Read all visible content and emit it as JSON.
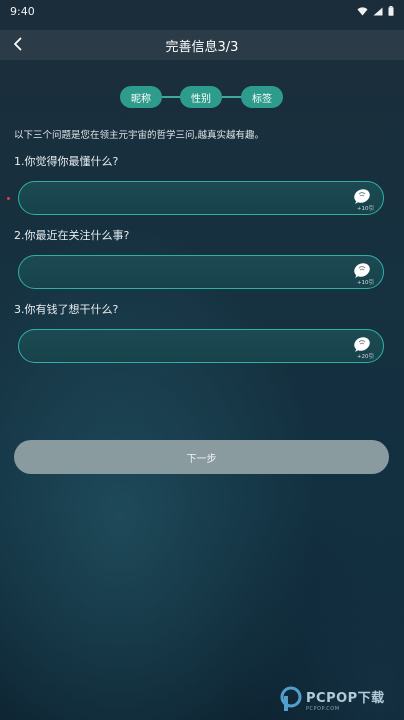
{
  "status_bar": {
    "time": "9:40",
    "icons": [
      "wifi-icon",
      "signal-icon",
      "battery-icon"
    ]
  },
  "header": {
    "title": "完善信息3/3",
    "back_icon": "chevron-left-icon"
  },
  "steps": [
    "昵称",
    "性别",
    "标签"
  ],
  "intro": "以下三个问题是您在领主元宇宙的哲学三问,越真实越有趣。",
  "questions": [
    {
      "label": "1.你觉得你最懂什么?",
      "value": "",
      "count": "+10引"
    },
    {
      "label": "2.你最近在关注什么事?",
      "value": "",
      "count": "+10引"
    },
    {
      "label": "3.你有钱了想干什么?",
      "value": "",
      "count": "+20引"
    }
  ],
  "next_button": "下一步",
  "watermark": {
    "main": "PCPOP下载",
    "sub": "PCPOP.COM"
  },
  "colors": {
    "accent": "#2e9c8c",
    "input_border": "#2fb0a3",
    "header_bg": "#2b3b47",
    "button_bg": "#8a9ba0"
  }
}
